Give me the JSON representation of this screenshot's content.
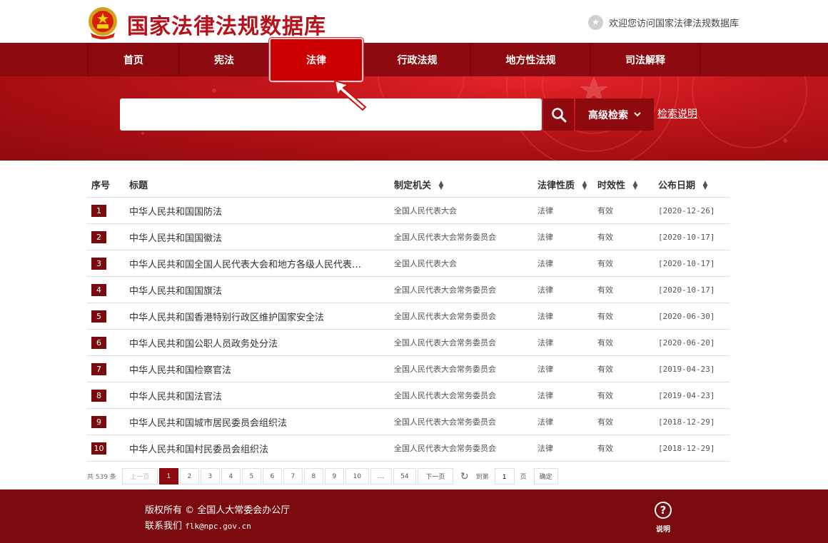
{
  "header": {
    "site_title": "国家法律法规数据库",
    "welcome": "欢迎您访问国家法律法规数据库"
  },
  "nav": {
    "items": [
      {
        "label": "首页"
      },
      {
        "label": "宪法"
      },
      {
        "label": "法律"
      },
      {
        "label": "行政法规"
      },
      {
        "label": "地方性法规"
      },
      {
        "label": "司法解释"
      }
    ],
    "active": "法律"
  },
  "search": {
    "value": "",
    "advanced_label": "高级检索",
    "help_label": "检索说明"
  },
  "table": {
    "headers": {
      "no": "序号",
      "title": "标题",
      "org": "制定机关",
      "type": "法律性质",
      "valid": "时效性",
      "date": "公布日期"
    },
    "rows": [
      {
        "no": "1",
        "title": "中华人民共和国国防法",
        "org": "全国人民代表大会",
        "type": "法律",
        "valid": "有效",
        "date": "[2020-12-26]"
      },
      {
        "no": "2",
        "title": "中华人民共和国国徽法",
        "org": "全国人民代表大会常务委员会",
        "type": "法律",
        "valid": "有效",
        "date": "[2020-10-17]"
      },
      {
        "no": "3",
        "title": "中华人民共和国全国人民代表大会和地方各级人民代表…",
        "org": "全国人民代表大会",
        "type": "法律",
        "valid": "有效",
        "date": "[2020-10-17]"
      },
      {
        "no": "4",
        "title": "中华人民共和国国旗法",
        "org": "全国人民代表大会常务委员会",
        "type": "法律",
        "valid": "有效",
        "date": "[2020-10-17]"
      },
      {
        "no": "5",
        "title": "中华人民共和国香港特别行政区维护国家安全法",
        "org": "全国人民代表大会常务委员会",
        "type": "法律",
        "valid": "有效",
        "date": "[2020-06-30]"
      },
      {
        "no": "6",
        "title": "中华人民共和国公职人员政务处分法",
        "org": "全国人民代表大会常务委员会",
        "type": "法律",
        "valid": "有效",
        "date": "[2020-06-20]"
      },
      {
        "no": "7",
        "title": "中华人民共和国检察官法",
        "org": "全国人民代表大会常务委员会",
        "type": "法律",
        "valid": "有效",
        "date": "[2019-04-23]"
      },
      {
        "no": "8",
        "title": "中华人民共和国法官法",
        "org": "全国人民代表大会常务委员会",
        "type": "法律",
        "valid": "有效",
        "date": "[2019-04-23]"
      },
      {
        "no": "9",
        "title": "中华人民共和国城市居民委员会组织法",
        "org": "全国人民代表大会常务委员会",
        "type": "法律",
        "valid": "有效",
        "date": "[2018-12-29]"
      },
      {
        "no": "10",
        "title": "中华人民共和国村民委员会组织法",
        "org": "全国人民代表大会常务委员会",
        "type": "法律",
        "valid": "有效",
        "date": "[2018-12-29]"
      }
    ]
  },
  "pager": {
    "total": "共 539 条",
    "prev": "上一页",
    "pages": [
      "1",
      "2",
      "3",
      "4",
      "5",
      "6",
      "7",
      "8",
      "9",
      "10",
      "…",
      "54"
    ],
    "current": "1",
    "next": "下一页",
    "goto_label": "到第",
    "goto_value": "1",
    "page_unit": "页",
    "confirm": "确定"
  },
  "footer": {
    "copyright": "版权所有 © 全国人大常委会办公厅",
    "contact_label": "联系我们",
    "email": "flk@npc.gov.cn",
    "help_label": "说明"
  },
  "colors": {
    "brand_red": "#b5121b",
    "nav_bg": "#8c0a0f",
    "active_tab": "#cc0000",
    "footer_bg": "#7a0a0d"
  }
}
